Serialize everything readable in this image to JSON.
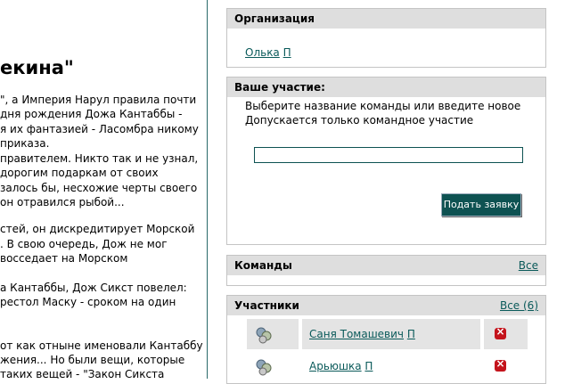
{
  "left": {
    "title": "екина\"",
    "lines": [
      "\", а Империя Нарул правила почти",
      "дня рождения Дожа Кантаббы -",
      "я их фантазией - Ласомбра никому",
      "приказа.",
      "правителем. Никто так и не узнал,",
      "дорогим подаркам от своих",
      "залось бы, несхожие черты своего",
      "он отравился рыбой...",
      "стей, он дискредитирует Морской",
      ". В свою очередь, Дож не мог",
      "восседает на Морском",
      "а Кантаббы, Дож Сикст повелел:",
      "рестол Маску - сроком на один",
      "от как отныне именовали Кантаббу",
      "жения... Но были вещи, которые",
      "таких вещей - \"Закон Сикста"
    ]
  },
  "org": {
    "header": "Организация",
    "member_name": "Олька",
    "member_marker": "П"
  },
  "participation": {
    "header": "Ваше участие:",
    "line1": "Выберите название команды или введите новое",
    "line2": "Допускается только командное участие",
    "input_value": "",
    "button_label": "Подать заявку"
  },
  "teams": {
    "header": "Команды",
    "all_link": "Все"
  },
  "participants": {
    "header": "Участники",
    "all_link": "Все (6)",
    "rows": [
      {
        "name": "Саня Томашевич",
        "marker": "П"
      },
      {
        "name": "Арьюшка",
        "marker": "П"
      }
    ]
  },
  "colors": {
    "accent": "#0e5252",
    "header_bg": "#dedede",
    "delete": "#c4141c"
  }
}
